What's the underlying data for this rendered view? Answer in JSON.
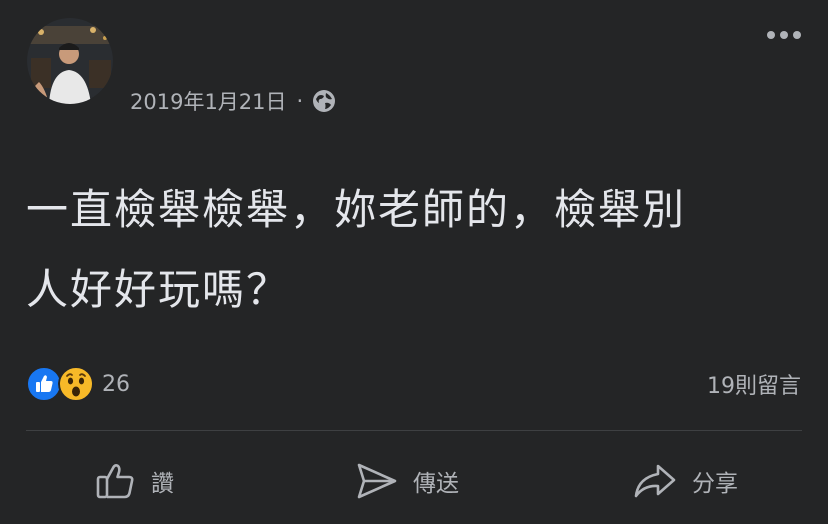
{
  "post": {
    "date": "2019年1月21日",
    "separator": "·",
    "privacy_icon": "globe-icon",
    "more_icon": "more-options-icon",
    "text": "一直檢舉檢舉，妳老師的，檢舉別\n人好好玩嗎？",
    "reactions": {
      "icons": [
        "like-reaction-icon",
        "wow-reaction-icon"
      ],
      "count": "26"
    },
    "comments_label": "19則留言"
  },
  "actions": {
    "like_label": "讚",
    "send_label": "傳送",
    "share_label": "分享"
  },
  "colors": {
    "background": "#242526",
    "primary_text": "#e4e6eb",
    "secondary_text": "#b0b3b8",
    "like_blue": "#1877f2",
    "wow_yellow": "#f7b928"
  }
}
